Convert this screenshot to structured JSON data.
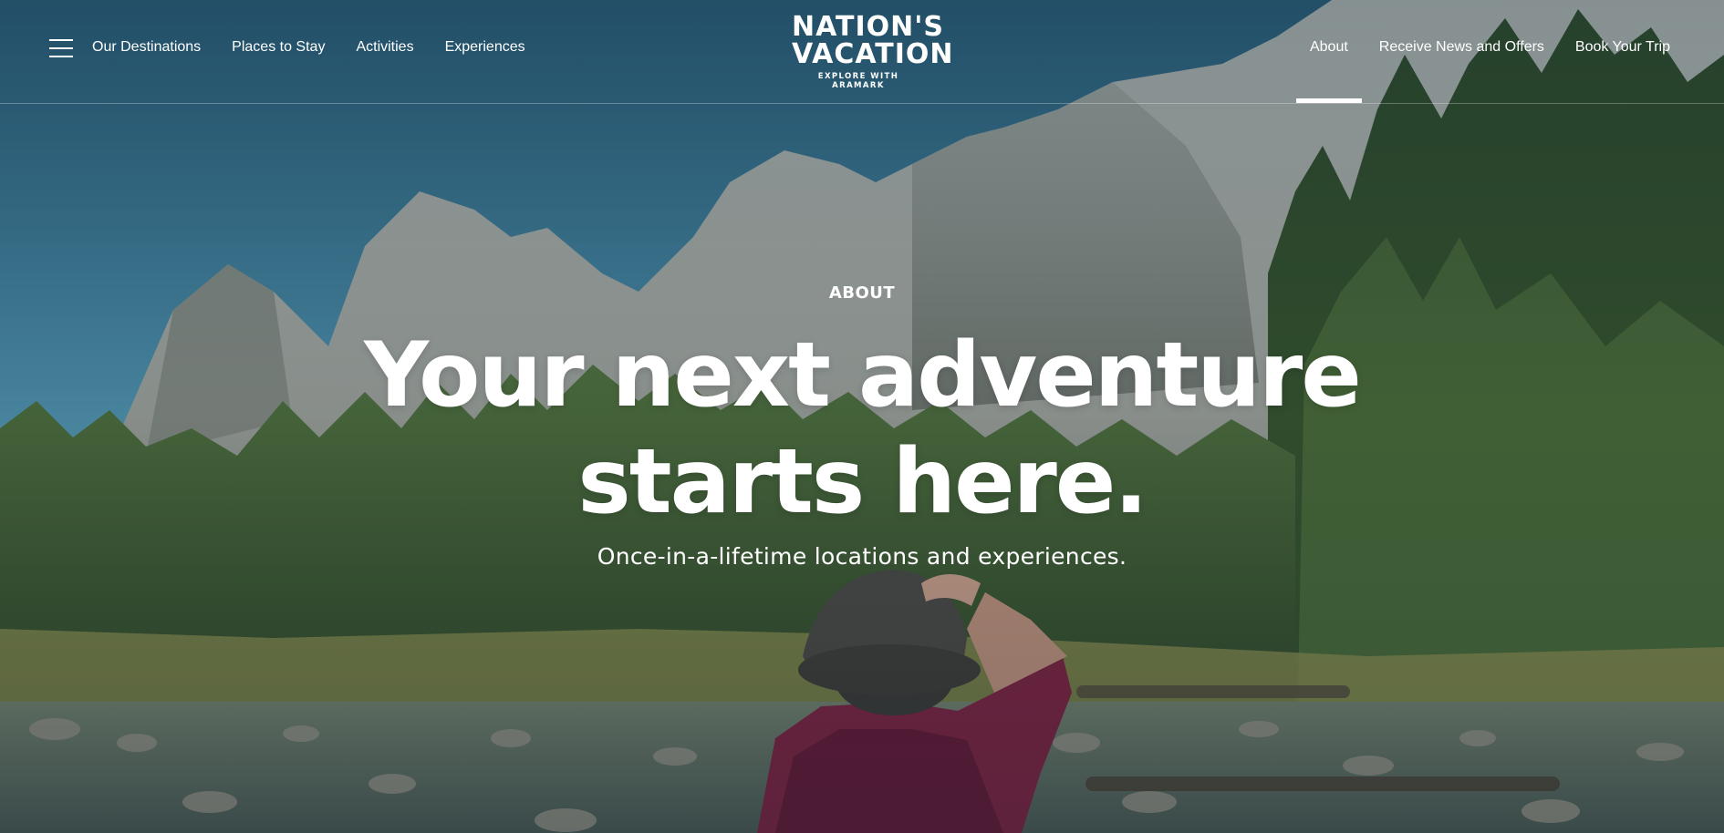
{
  "brand": {
    "name_line1": "NATION'S",
    "name_line2": "VACATION",
    "tagline": "EXPLORE WITH ARAMARK"
  },
  "nav": {
    "left": [
      {
        "label": "Our Destinations"
      },
      {
        "label": "Places to Stay"
      },
      {
        "label": "Activities"
      },
      {
        "label": "Experiences"
      }
    ],
    "right": [
      {
        "label": "About",
        "active": true
      },
      {
        "label": "Receive News and Offers"
      },
      {
        "label": "Book Your Trip"
      }
    ]
  },
  "hero": {
    "eyebrow": "ABOUT",
    "headline_line1": "Your next adventure",
    "headline_line2": "starts here.",
    "subhead": "Once-in-a-lifetime locations and experiences."
  },
  "icons": {
    "menu": "hamburger-menu-icon"
  },
  "colors": {
    "text": "#ffffff",
    "sky_top": "#2f6b8a",
    "sky_bottom": "#5f9db5",
    "forest": "#3d5a34",
    "rock": "#9ea3a0"
  }
}
